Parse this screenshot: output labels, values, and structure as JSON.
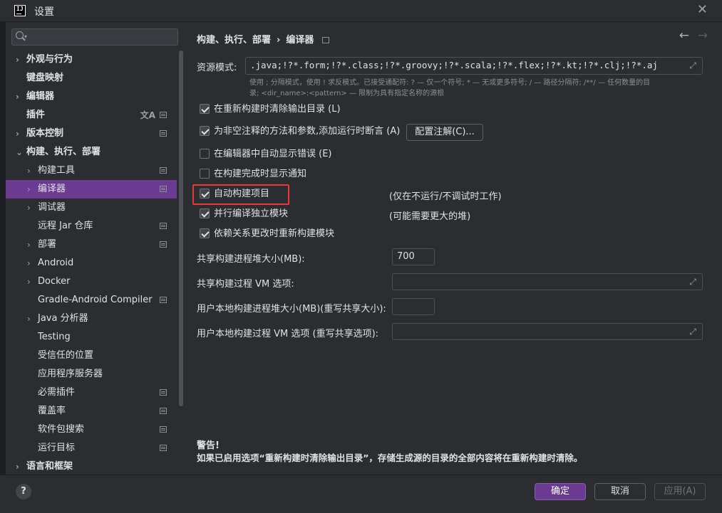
{
  "window": {
    "title": "设置"
  },
  "search": {
    "placeholder": ""
  },
  "sidebar": {
    "items": [
      {
        "label": "外观与行为"
      },
      {
        "label": "键盘映射"
      },
      {
        "label": "编辑器"
      },
      {
        "label": "插件"
      },
      {
        "label": "版本控制"
      },
      {
        "label": "构建、执行、部署"
      },
      {
        "label": "构建工具"
      },
      {
        "label": "编译器"
      },
      {
        "label": "调试器"
      },
      {
        "label": "远程 Jar 仓库"
      },
      {
        "label": "部署"
      },
      {
        "label": "Android"
      },
      {
        "label": "Docker"
      },
      {
        "label": "Gradle-Android Compiler"
      },
      {
        "label": "Java 分析器"
      },
      {
        "label": "Testing"
      },
      {
        "label": "受信任的位置"
      },
      {
        "label": "应用程序服务器"
      },
      {
        "label": "必需插件"
      },
      {
        "label": "覆盖率"
      },
      {
        "label": "软件包搜索"
      },
      {
        "label": "运行目标"
      },
      {
        "label": "语言和框架"
      }
    ]
  },
  "header": {
    "breadcrumb_parent": "构建、执行、部署",
    "breadcrumb_sep": "›",
    "breadcrumb_current": "编译器"
  },
  "resource": {
    "label": "资源模式:",
    "value": ".java;!?*.form;!?*.class;!?*.groovy;!?*.scala;!?*.flex;!?*.kt;!?*.clj;!?*.aj",
    "hint_line1": "使用 ; 分隔模式，使用 ! 求反模式。已接受通配符: ? — 仅一个符号; * — 无或更多符号; / — 路径分隔符; /**/ — 任何数量的目",
    "hint_line2": "录; <dir_name>:<pattern> — 限制为具有指定名称的源根"
  },
  "options": {
    "clear_output": {
      "label": "在重新构建时清除输出目录 (L)",
      "checked": true
    },
    "add_assertions": {
      "label": "为非空注释的方法和参数,添加运行时断言 (A)",
      "checked": true
    },
    "configure_annotations": "配置注解(C)...",
    "auto_show_errors": {
      "label": "在编辑器中自动显示错误 (E)",
      "checked": false
    },
    "notify_done": {
      "label": "在构建完成时显示通知",
      "checked": false
    },
    "auto_build": {
      "label": "自动构建项目",
      "checked": true,
      "note": "(仅在不运行/不调试时工作)"
    },
    "parallel": {
      "label": "并行编译独立模块",
      "checked": true,
      "note": "(可能需要更大的堆)"
    },
    "rebuild_deps": {
      "label": "依赖关系更改时重新构建模块",
      "checked": true
    }
  },
  "fields": {
    "shared_heap_label": "共享构建进程堆大小(MB):",
    "shared_heap_value": "700",
    "shared_vm_label": "共享构建过程 VM 选项:",
    "shared_vm_value": "",
    "local_heap_label": "用户本地构建进程堆大小(MB)(重写共享大小):",
    "local_heap_value": "",
    "local_vm_label": "用户本地构建过程 VM 选项 (重写共享选项):",
    "local_vm_value": ""
  },
  "warning": {
    "title": "警告!",
    "text": "如果已启用选项“重新构建时清除输出目录”，存储生成源的目录的全部内容将在重新构建时清除。"
  },
  "footer": {
    "help": "?",
    "ok": "确定",
    "cancel": "取消",
    "apply": "应用(A)"
  },
  "colors": {
    "accent": "#6b3b91",
    "highlight": "#e53935",
    "background": "#2b2d30"
  },
  "icons": [
    "app-logo-icon",
    "close-icon",
    "search-icon",
    "expand-arrow-icon",
    "page-icon",
    "translate-icon",
    "back-arrow-icon",
    "forward-arrow-icon",
    "expand-field-icon",
    "checkbox-icon",
    "help-icon"
  ]
}
